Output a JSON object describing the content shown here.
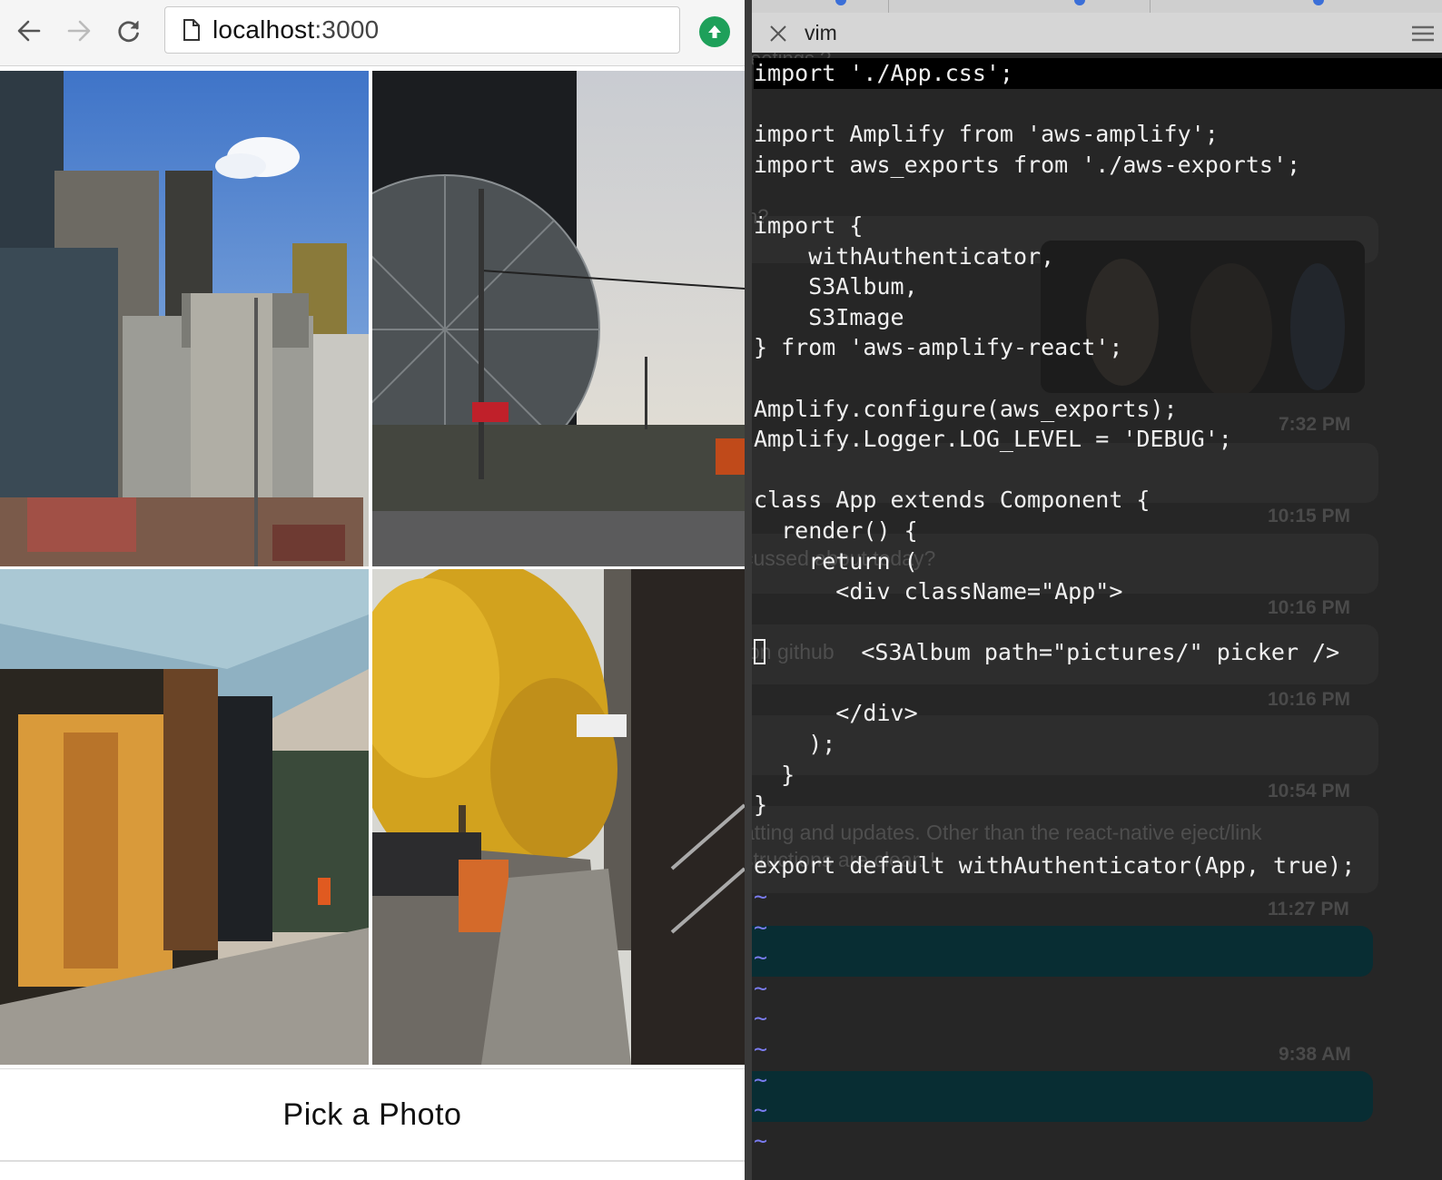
{
  "browser": {
    "url_host": "localhost",
    "url_port": ":3000",
    "pick_label": "Pick a Photo",
    "photos": [
      {
        "icon": "city-skyline-photo"
      },
      {
        "icon": "spheres-photo"
      },
      {
        "icon": "storefront-photo"
      },
      {
        "icon": "autumn-street-photo"
      }
    ]
  },
  "vim": {
    "tab_title": "vim",
    "code_lines": [
      "import './App.css';",
      "",
      "import Amplify from 'aws-amplify';",
      "import aws_exports from './aws-exports';",
      "",
      "import {",
      "    withAuthenticator,",
      "    S3Album,",
      "    S3Image",
      "} from 'aws-amplify-react';",
      "",
      "Amplify.configure(aws_exports);",
      "Amplify.Logger.LOG_LEVEL = 'DEBUG';",
      "",
      "class App extends Component {",
      "  render() {",
      "    return (",
      "      <div className=\"App\">",
      "",
      "        <S3Album path=\"pictures/\" picker />",
      "",
      "      </div>",
      "    );",
      "  }",
      "}",
      "",
      "export default withAuthenticator(App, true);",
      "~",
      "~",
      "~",
      "~",
      "~",
      "~",
      "~",
      "~",
      "~"
    ],
    "background_chat": {
      "times": [
        "7:32 PM",
        "10:15 PM",
        "10:16 PM",
        "10:16 PM",
        "10:54 PM",
        "11:27 PM",
        "9:38 AM"
      ],
      "fragments": [
        "eetings ?",
        "n?",
        "cussed about today?",
        "on github",
        "atting and updates. Other than the react-native eject/link",
        "structions are clear. I"
      ]
    }
  },
  "colors": {
    "accent_green": "#1ea05a",
    "vim_tilde": "#7a7cf0",
    "editor_bg": "#262626"
  }
}
